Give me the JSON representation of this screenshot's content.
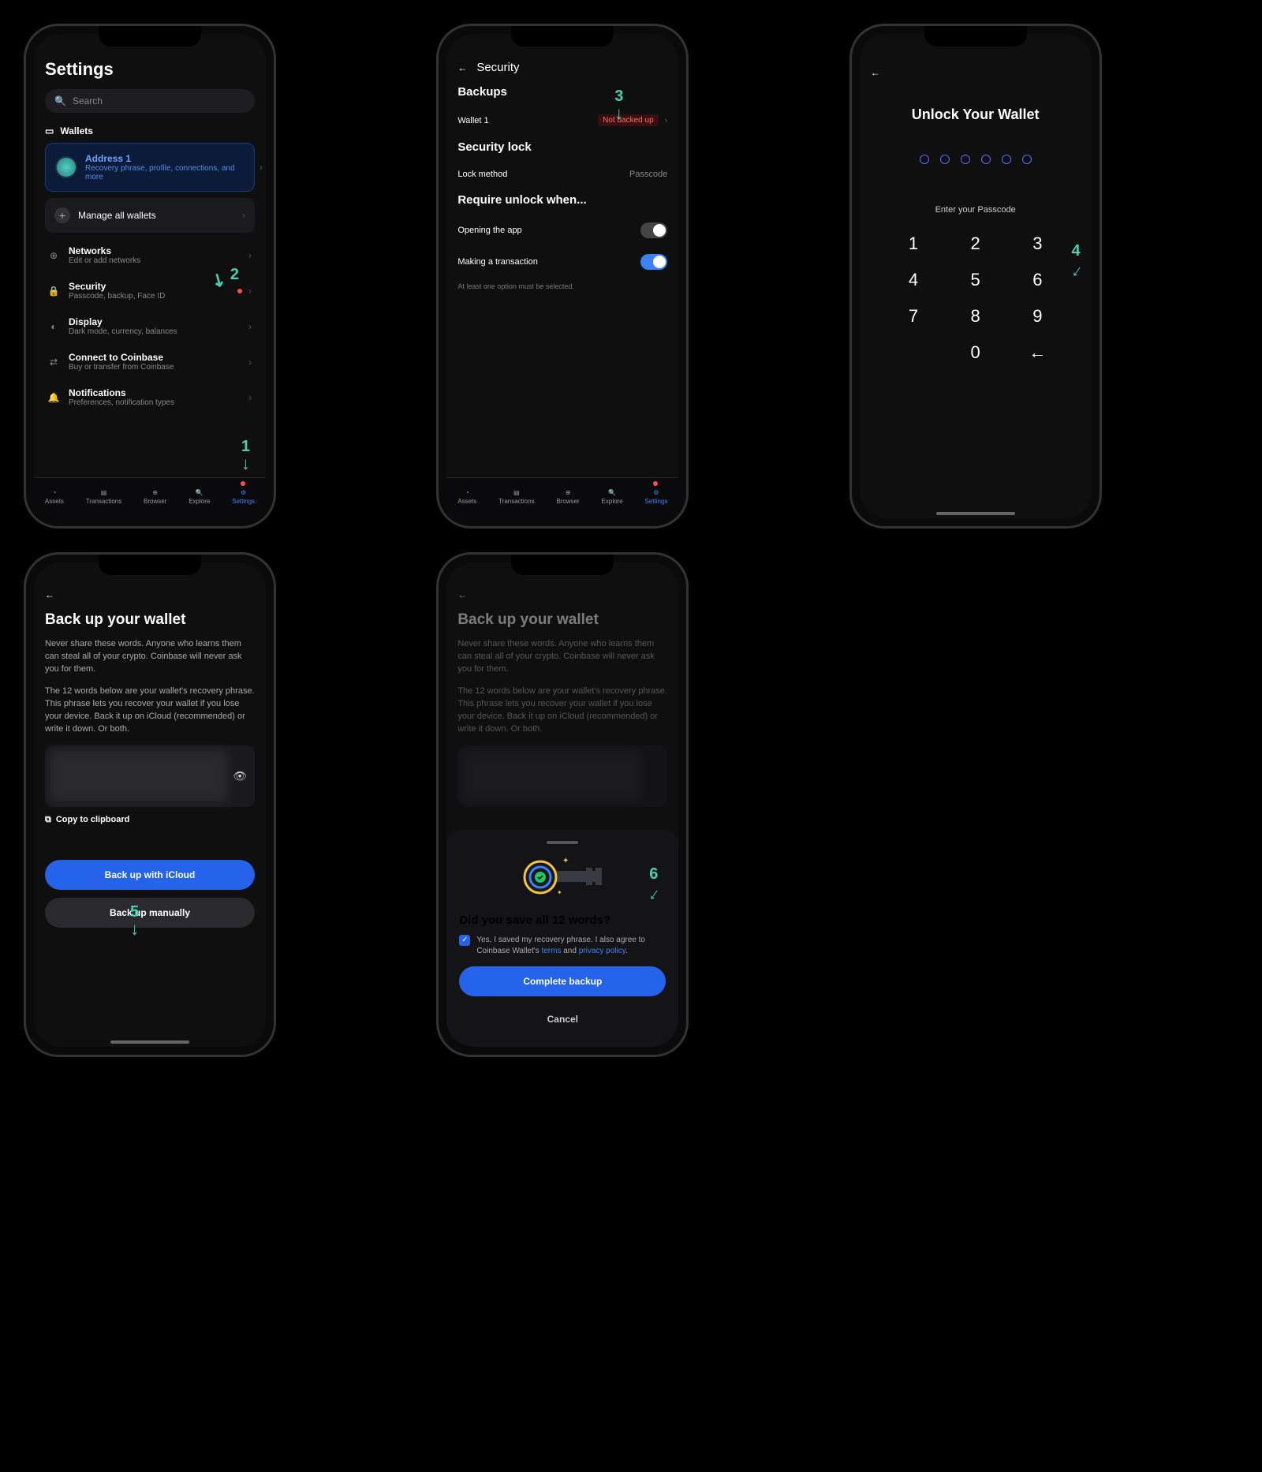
{
  "s1": {
    "title": "Settings",
    "search_ph": "Search",
    "wallets_label": "Wallets",
    "addr_title": "Address 1",
    "addr_sub": "Recovery phrase, profile, connections, and more",
    "manage": "Manage all wallets",
    "rows": [
      {
        "icon": "⊕",
        "t": "Networks",
        "s": "Edit or add networks"
      },
      {
        "icon": "🔒",
        "t": "Security",
        "s": "Passcode, backup, Face ID"
      },
      {
        "icon": "◐",
        "t": "Display",
        "s": "Dark mode, currency, balances"
      },
      {
        "icon": "⇄",
        "t": "Connect to Coinbase",
        "s": "Buy or transfer from Coinbase"
      },
      {
        "icon": "🔔",
        "t": "Notifications",
        "s": "Preferences, notification types"
      }
    ]
  },
  "nav": [
    {
      "icon": "◔",
      "label": "Assets"
    },
    {
      "icon": "▤",
      "label": "Transactions"
    },
    {
      "icon": "⊕",
      "label": "Browser"
    },
    {
      "icon": "🔍",
      "label": "Explore"
    },
    {
      "icon": "⚙",
      "label": "Settings"
    }
  ],
  "s2": {
    "title": "Security",
    "backups": "Backups",
    "wallet": "Wallet 1",
    "badge": "Not backed up",
    "seclock": "Security lock",
    "lockmethod": "Lock method",
    "lockval": "Passcode",
    "require": "Require unlock when...",
    "opening": "Opening the app",
    "making": "Making a transaction",
    "hint": "At least one option must be selected."
  },
  "s3": {
    "title": "Unlock Your Wallet",
    "sub": "Enter your Passcode",
    "keys": [
      "1",
      "2",
      "3",
      "4",
      "5",
      "6",
      "7",
      "8",
      "9",
      "",
      "0",
      "←"
    ]
  },
  "s4": {
    "title": "Back up your wallet",
    "p1": "Never share these words. Anyone who learns them can steal all of your crypto. Coinbase will never ask you for them.",
    "p2": "The 12 words below are your wallet's recovery phrase. This phrase lets you recover your wallet if you lose your device. Back it up on iCloud (recommended) or write it down. Or both.",
    "copy": "Copy to clipboard",
    "btn1": "Back up with iCloud",
    "btn2": "Back up manually"
  },
  "s5": {
    "title": "Back up your wallet",
    "sheet_title": "Did you save all 12 words?",
    "chk": "Yes, I saved my recovery phrase. I also agree to Coinbase Wallet's ",
    "terms": "terms",
    "and": " and ",
    "pp": "privacy policy",
    "complete": "Complete backup",
    "cancel": "Cancel"
  },
  "annots": {
    "a1": "1",
    "a2": "2",
    "a3": "3",
    "a4": "4",
    "a5": "5",
    "a6": "6"
  }
}
